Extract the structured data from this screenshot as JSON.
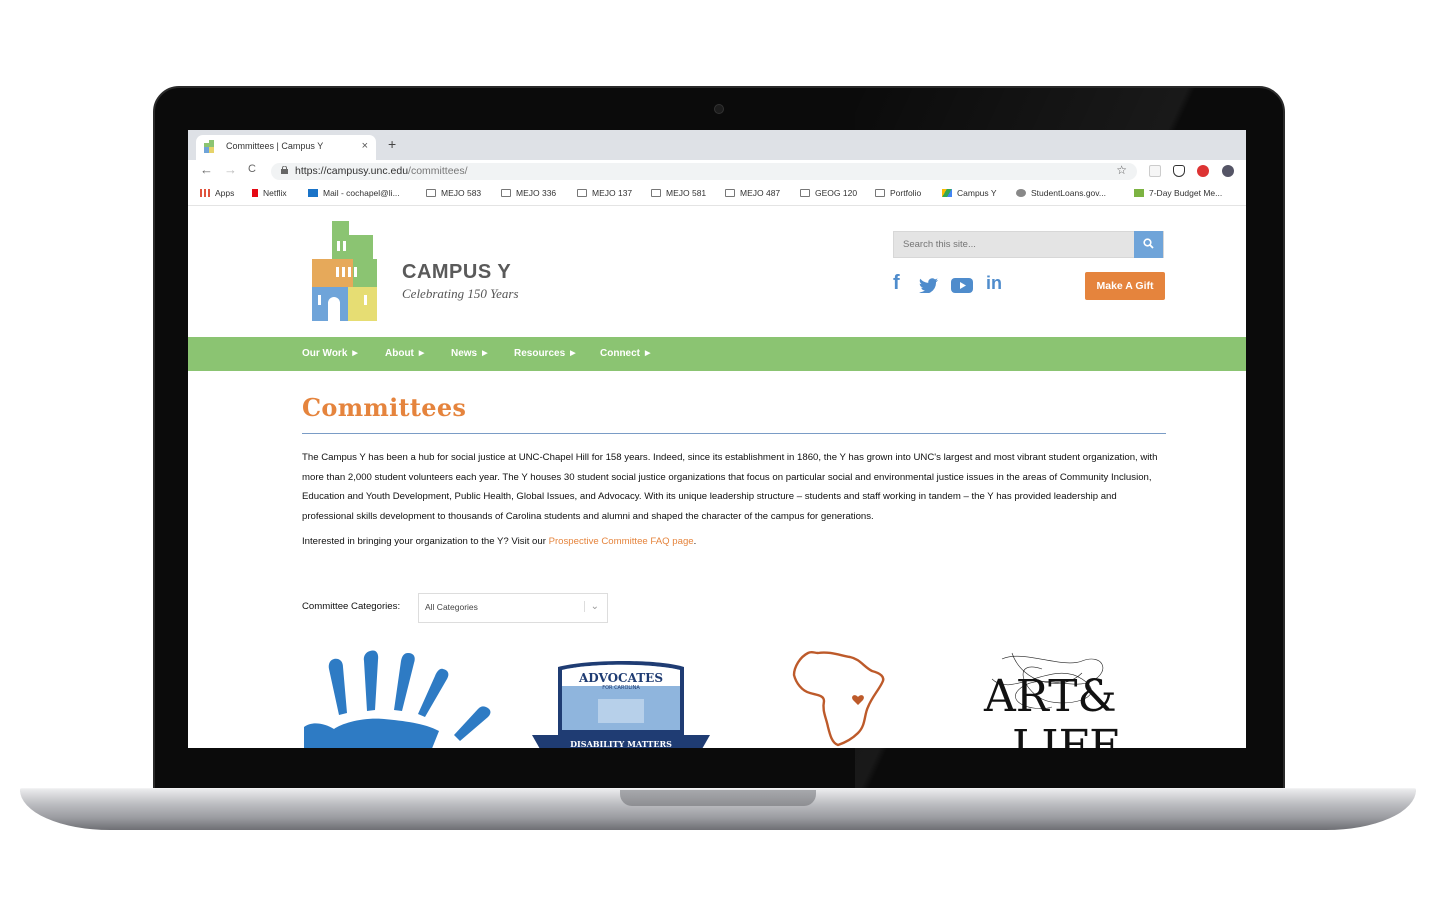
{
  "browser": {
    "tab_title": "Committees | Campus Y",
    "tab_close": "×",
    "new_tab": "+",
    "back": "←",
    "forward": "→",
    "reload": "C",
    "url_host": "https://campusy.unc.edu",
    "url_path": "/committees/",
    "star": "☆",
    "bookmarks": [
      "Apps",
      "Netflix",
      "Mail - cochapel@li...",
      "MEJO 583",
      "MEJO 336",
      "MEJO 137",
      "MEJO 581",
      "MEJO 487",
      "GEOG 120",
      "Portfolio",
      "Campus Y",
      "StudentLoans.gov...",
      "7-Day Budget Me..."
    ]
  },
  "header": {
    "logo_name": "CAMPUS Y",
    "logo_tagline": "Celebrating 150 Years",
    "search_placeholder": "Search this site...",
    "search_icon": "search-icon",
    "social": [
      "f",
      "twitter-icon",
      "youtube-icon",
      "in"
    ],
    "gift_label": "Make A Gift"
  },
  "nav": {
    "items": [
      "Our Work",
      "About",
      "News",
      "Resources",
      "Connect"
    ]
  },
  "main": {
    "title": "Committees",
    "intro": "The Campus Y has been a hub for social justice at UNC-Chapel Hill for 158 years. Indeed, since its establishment in 1860, the Y has grown into UNC's largest and most vibrant student organization, with more than 2,000 student volunteers each year. The Y houses 30 student social justice organizations that focus on particular social and environmental justice issues in the areas of Community Inclusion, Education and Youth Development, Public Health, Global Issues, and Advocacy. With its unique leadership structure – students and staff working in tandem – the Y has provided leadership and professional skills development to thousands of Carolina students and alumni and shaped the character of the campus for generations.",
    "faq_prefix": "Interested in bringing your organization to the Y? Visit our ",
    "faq_link": "Prospective Committee FAQ page",
    "faq_suffix": ".",
    "categories_label": "Committee Categories:",
    "categories_value": "All Categories",
    "tile_texts": {
      "advocates": "ADVOCATES",
      "advocates_sub": "FOR CAROLINA",
      "advocates_banner": "DISABILITY MATTERS",
      "art_life_1": "ART&",
      "art_life_2": "LIFE"
    }
  },
  "colors": {
    "accent_orange": "#e5843d",
    "nav_green": "#8bc472",
    "link_blue": "#4f8ccc"
  }
}
